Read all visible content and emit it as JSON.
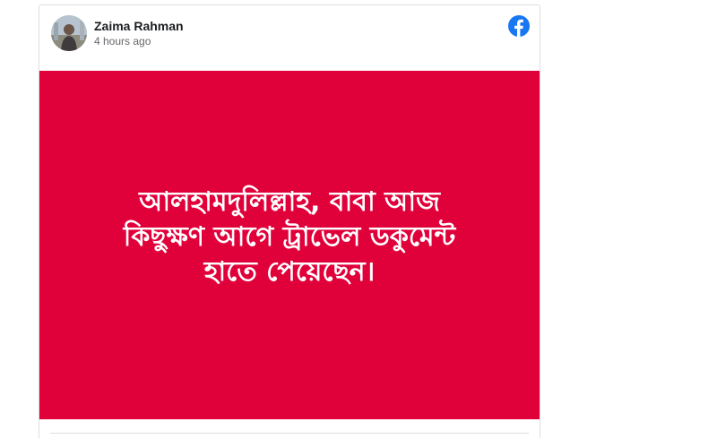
{
  "post": {
    "author": "Zaima Rahman",
    "timestamp": "4 hours ago",
    "image_text_lines": [
      "আলহামদুলিল্লাহ, বাবা আজ",
      "কিছুক্ষণ আগে ট্রাভেল ডকুমেন্ট",
      "হাতে পেয়েছেন।"
    ],
    "image_background": "#e0003a",
    "image_text_color": "#ffffff"
  },
  "icons": {
    "platform_logo": "facebook-icon",
    "avatar": "avatar-photo"
  },
  "colors": {
    "facebook_blue": "#1877f2",
    "name": "#1c1e21",
    "secondary_text": "#65676b"
  }
}
